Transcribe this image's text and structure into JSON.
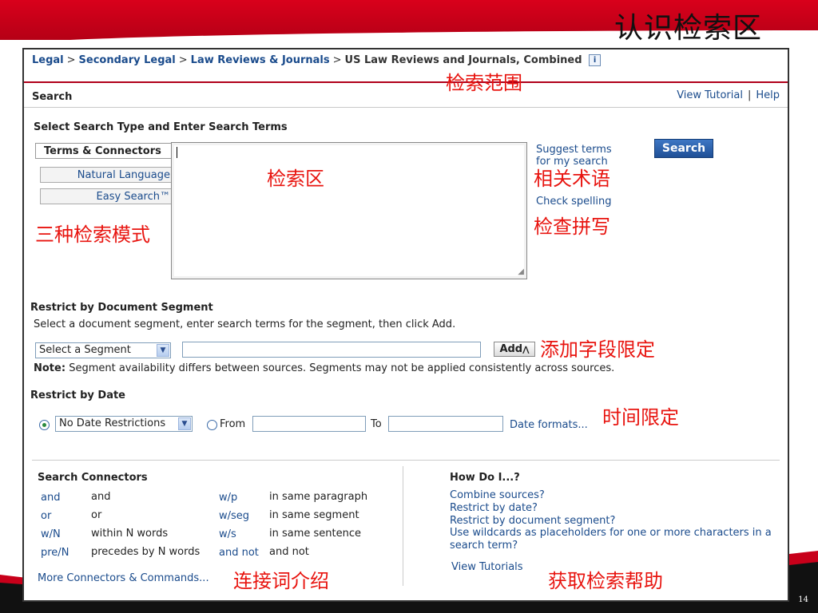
{
  "slide": {
    "title": "认识检索区",
    "page_number": "14"
  },
  "breadcrumb": {
    "items": [
      "Legal",
      "Secondary Legal",
      "Law Reviews & Journals"
    ],
    "current": "US Law Reviews and Journals, Combined",
    "separator": ">",
    "info_icon": "i"
  },
  "header": {
    "title": "Search",
    "view_tutorial": "View Tutorial",
    "help": "Help",
    "bar": "|"
  },
  "search_section": {
    "title": "Select Search Type and Enter Search Terms",
    "modes": [
      "Terms & Connectors",
      "Natural Language",
      "Easy Search™"
    ],
    "suggest_terms": "Suggest terms",
    "suggest_terms_2": "for my search",
    "check_spelling": "Check spelling",
    "search_button": "Search"
  },
  "segment_section": {
    "title": "Restrict by Document Segment",
    "instruction": "Select a document segment, enter search terms for the segment, then click Add.",
    "select_value": "Select a Segment",
    "add_button": "Add",
    "note_label": "Note:",
    "note_text": "Segment availability differs between sources. Segments may not be applied consistently across sources."
  },
  "date_section": {
    "title": "Restrict by Date",
    "select_value": "No Date Restrictions",
    "from_label": "From",
    "to_label": "To",
    "formats_link": "Date formats..."
  },
  "connectors": {
    "title": "Search Connectors",
    "left": [
      {
        "code": "and",
        "desc": "and"
      },
      {
        "code": "or",
        "desc": "or"
      },
      {
        "code": "w/N",
        "desc": "within N words"
      },
      {
        "code": "pre/N",
        "desc": "precedes by N words"
      }
    ],
    "right": [
      {
        "code": "w/p",
        "desc": "in same paragraph"
      },
      {
        "code": "w/seg",
        "desc": "in same segment"
      },
      {
        "code": "w/s",
        "desc": "in same sentence"
      },
      {
        "code": "and not",
        "desc": "and not"
      }
    ],
    "more_link": "More Connectors & Commands..."
  },
  "howdo": {
    "title": "How Do I...?",
    "links": [
      "Combine sources?",
      "Restrict by date?",
      "Restrict by document segment?",
      "Use wildcards as placeholders for one or more characters in a search term?"
    ],
    "tutorials": "View Tutorials"
  },
  "annotations": {
    "scope": "检索范围",
    "search_area": "检索区",
    "related_terms": "相关术语",
    "check_spelling": "检查拼写",
    "three_modes": "三种检索模式",
    "add_segment": "添加字段限定",
    "date_limit": "时间限定",
    "connectors_intro": "连接词介绍",
    "get_help": "获取检索帮助"
  },
  "colors": {
    "slide_red": "#d9001b",
    "link_blue": "#1a4b8c",
    "annotation_red": "#e8140f"
  }
}
